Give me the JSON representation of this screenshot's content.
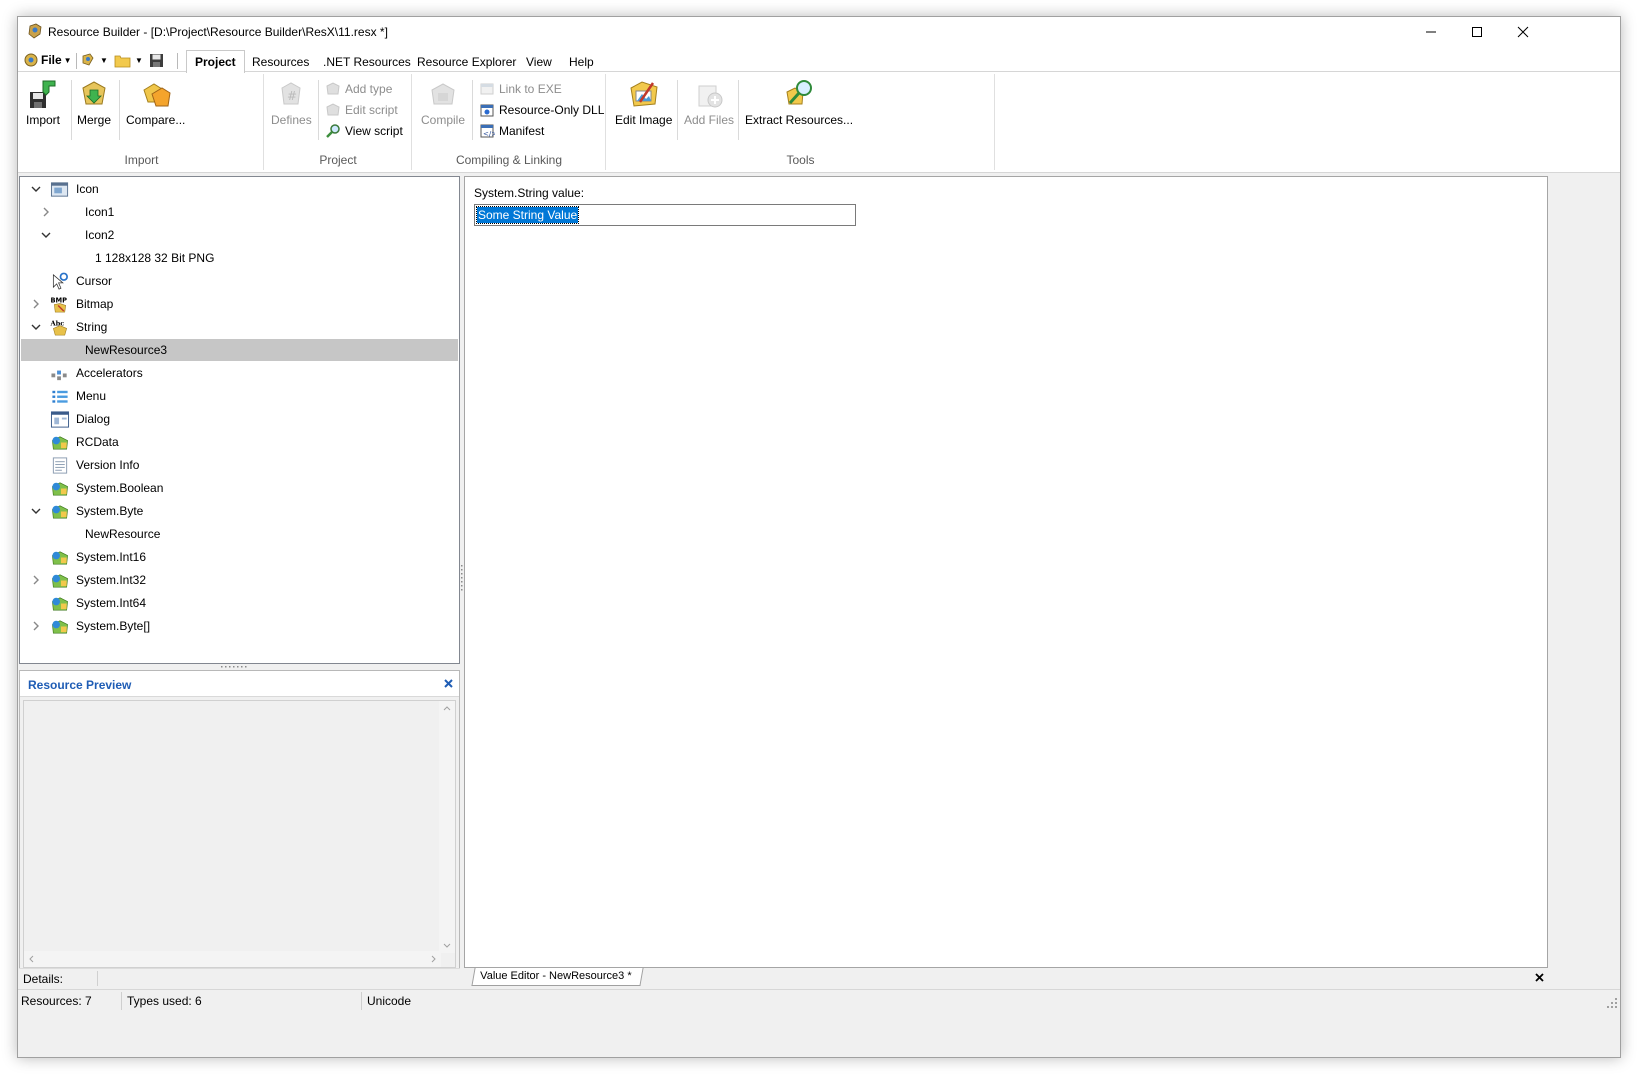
{
  "window": {
    "title": "Resource Builder - [D:\\Project\\Resource Builder\\ResX\\11.resx *]"
  },
  "menu": {
    "file_label": "File",
    "tabs": [
      {
        "label": "Project",
        "active": true
      },
      {
        "label": "Resources"
      },
      {
        "label": ".NET Resources"
      },
      {
        "label": "Resource Explorer"
      },
      {
        "label": "View"
      },
      {
        "label": "Help"
      }
    ]
  },
  "ribbon": {
    "groups": {
      "import": {
        "label": "Import",
        "buttons": [
          {
            "label": "Import"
          },
          {
            "label": "Merge"
          },
          {
            "label": "Compare..."
          }
        ]
      },
      "project": {
        "label": "Project",
        "defines": "Defines",
        "add_type": "Add type",
        "edit_script": "Edit script",
        "view_script": "View script"
      },
      "compiling": {
        "label": "Compiling & Linking",
        "compile": "Compile",
        "link_to_exe": "Link to EXE",
        "resource_only_dll": "Resource-Only DLL",
        "manifest": "Manifest"
      },
      "tools": {
        "label": "Tools",
        "edit_image": "Edit Image",
        "add_files": "Add Files",
        "extract_resources": "Extract Resources..."
      }
    }
  },
  "tree": {
    "nodes": [
      {
        "label": "Icon",
        "icon": "icon-type-icon",
        "expand": "expanded"
      },
      {
        "label": "Icon1",
        "icon": "",
        "expand": "collapsed"
      },
      {
        "label": "Icon2",
        "icon": "",
        "expand": "expanded"
      },
      {
        "label": "1 128x128 32 Bit PNG",
        "icon": "",
        "expand": ""
      },
      {
        "label": "Cursor",
        "icon": "cursor-icon",
        "expand": ""
      },
      {
        "label": "Bitmap",
        "icon": "bitmap-icon",
        "expand": "collapsed"
      },
      {
        "label": "String",
        "icon": "string-icon",
        "expand": "expanded"
      },
      {
        "label": "NewResource3",
        "icon": "",
        "expand": "",
        "selected": true
      },
      {
        "label": "Accelerators",
        "icon": "accelerators-icon",
        "expand": ""
      },
      {
        "label": "Menu",
        "icon": "menu-icon",
        "expand": ""
      },
      {
        "label": "Dialog",
        "icon": "dialog-icon",
        "expand": ""
      },
      {
        "label": "RCData",
        "icon": "rcdata-icon",
        "expand": ""
      },
      {
        "label": "Version Info",
        "icon": "version-info-icon",
        "expand": ""
      },
      {
        "label": "System.Boolean",
        "icon": "net-type-icon",
        "expand": ""
      },
      {
        "label": "System.Byte",
        "icon": "net-type-icon",
        "expand": "expanded"
      },
      {
        "label": "NewResource",
        "icon": "",
        "expand": ""
      },
      {
        "label": "System.Int16",
        "icon": "net-type-icon",
        "expand": ""
      },
      {
        "label": "System.Int32",
        "icon": "net-type-icon",
        "expand": "collapsed"
      },
      {
        "label": "System.Int64",
        "icon": "net-type-icon",
        "expand": ""
      },
      {
        "label": "System.Byte[]",
        "icon": "net-type-icon",
        "expand": "collapsed"
      }
    ]
  },
  "preview": {
    "title": "Resource Preview",
    "details_label": "Details:"
  },
  "editor": {
    "field_label": "System.String value:",
    "value": "Some String Value",
    "tab_label": "Value Editor - NewResource3 *"
  },
  "status": {
    "resources": "Resources: 7",
    "types_used": "Types used: 6",
    "encoding": "Unicode"
  },
  "colors": {
    "selection": "#0078d7",
    "tree_selected": "#c6c6c6",
    "panel_title": "#1f5db5"
  }
}
